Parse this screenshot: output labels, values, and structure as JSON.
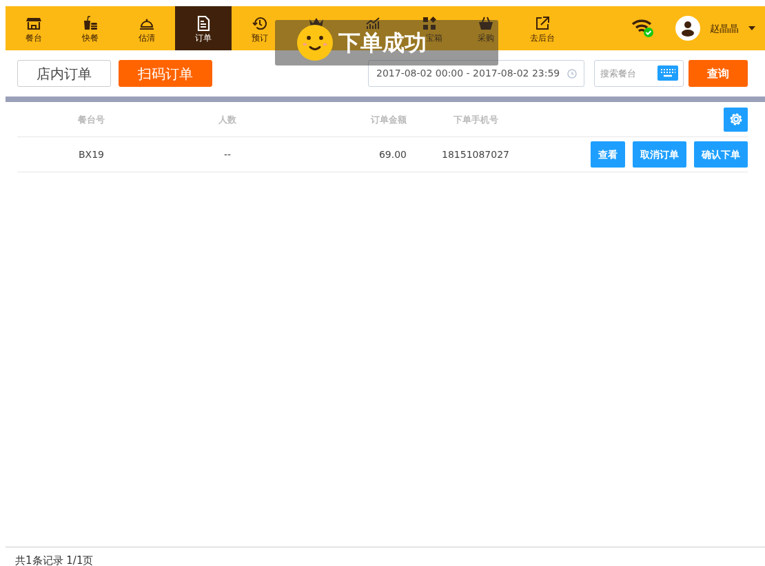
{
  "nav": [
    {
      "label": "餐台",
      "selected": false
    },
    {
      "label": "快餐",
      "selected": false
    },
    {
      "label": "估清",
      "selected": false
    },
    {
      "label": "订单",
      "selected": true
    },
    {
      "label": "预订",
      "selected": false
    },
    {
      "selected": false
    },
    {
      "selected": false
    },
    {
      "label": "宝箱",
      "selected": false
    },
    {
      "label": "采购",
      "selected": false
    },
    {
      "label": "去后台",
      "selected": false
    }
  ],
  "user": {
    "name": "赵晶晶"
  },
  "order_tabs": [
    {
      "label": "店内订单",
      "selected": false
    },
    {
      "label": "扫码订单",
      "selected": true
    }
  ],
  "date_range": {
    "value": "2017-08-02 00:00 - 2017-08-02 23:59"
  },
  "search": {
    "placeholder": "搜索餐台"
  },
  "query_button": "查询",
  "table": {
    "columns": [
      "餐台号",
      "人数",
      "订单金额",
      "下单手机号"
    ],
    "rows": [
      {
        "cells": [
          "BX19",
          "--",
          "69.00",
          "18151087027"
        ],
        "actions": [
          "查看",
          "取消订单",
          "确认下单"
        ]
      }
    ]
  },
  "footer": "共1条记录 1/1页",
  "toast": "下单成功"
}
